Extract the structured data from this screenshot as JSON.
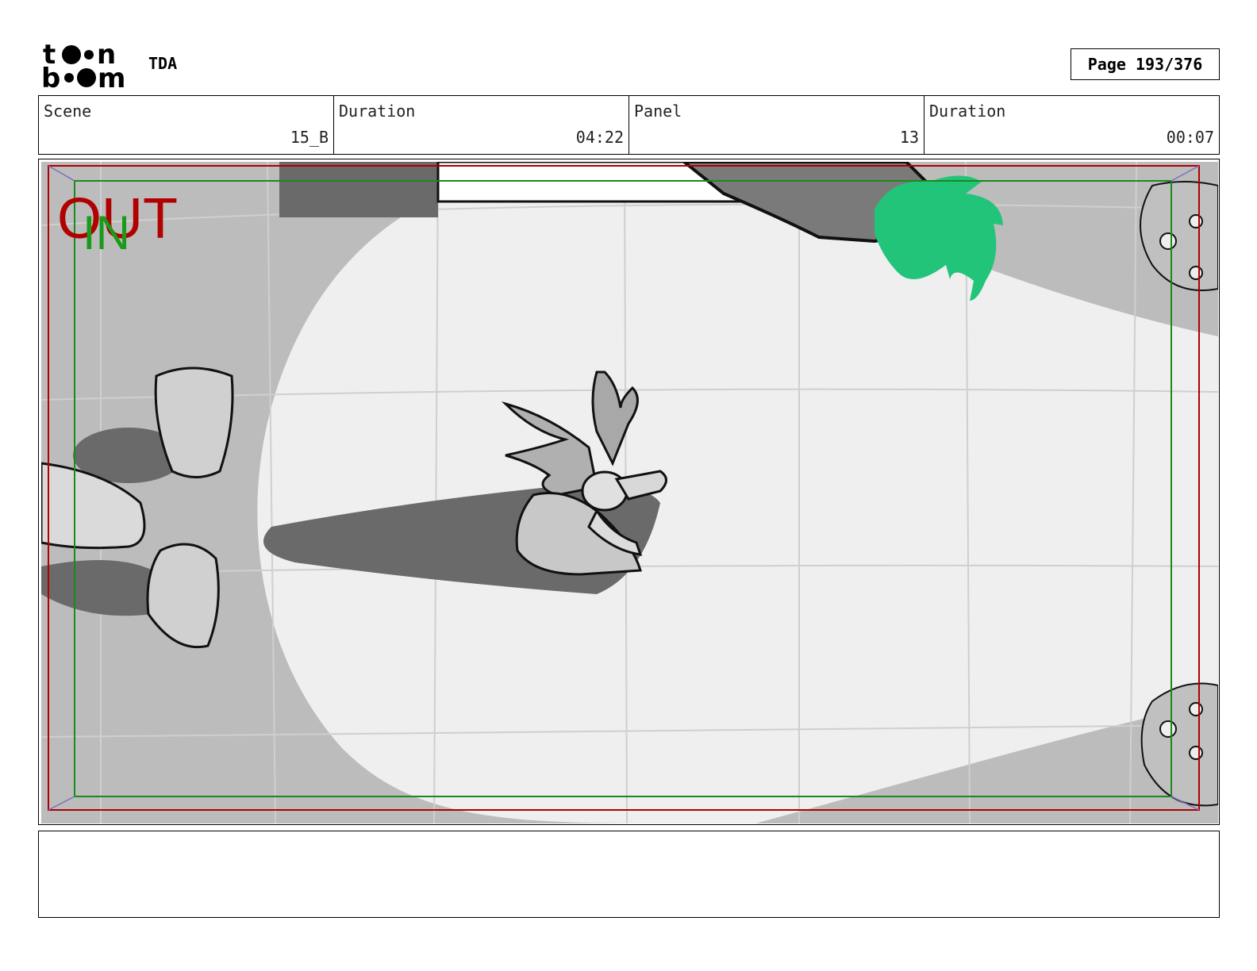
{
  "header": {
    "logo": "toon boom",
    "project": "TDA",
    "page": "Page 193/376"
  },
  "info": {
    "scene_label": "Scene",
    "scene_value": "15_B",
    "scene_duration_label": "Duration",
    "scene_duration_value": "04:22",
    "panel_label": "Panel",
    "panel_value": "13",
    "panel_duration_label": "Duration",
    "panel_duration_value": "00:07"
  },
  "panel": {
    "out_label": "OUT",
    "in_label": "IN",
    "colors": {
      "out_frame": "#b00000",
      "in_frame": "#1a8a1a",
      "green_blob": "#22c47a",
      "spotlight": "#efefef",
      "floor": "#bcbcbc",
      "shadow": "#6a6a6a"
    }
  },
  "notes": {
    "text": ""
  }
}
